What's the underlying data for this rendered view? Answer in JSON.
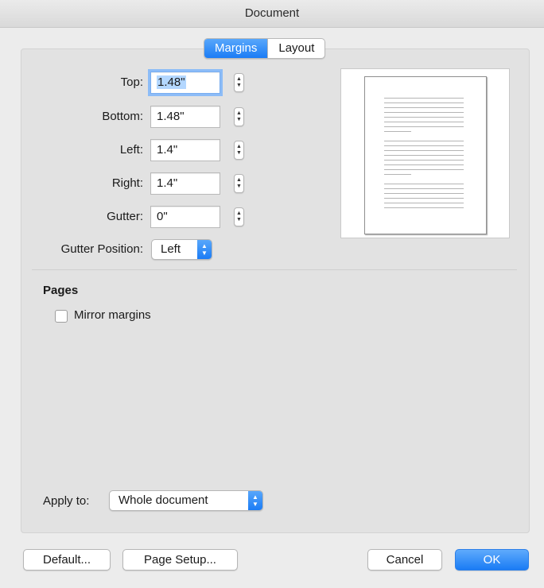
{
  "window": {
    "title": "Document"
  },
  "tabs": [
    {
      "label": "Margins",
      "active": true
    },
    {
      "label": "Layout",
      "active": false
    }
  ],
  "margins": {
    "top": {
      "label": "Top:",
      "value": "1.48\""
    },
    "bottom": {
      "label": "Bottom:",
      "value": "1.48\""
    },
    "left": {
      "label": "Left:",
      "value": "1.4\""
    },
    "right": {
      "label": "Right:",
      "value": "1.4\""
    },
    "gutter": {
      "label": "Gutter:",
      "value": "0\""
    },
    "gutter_position": {
      "label": "Gutter Position:",
      "value": "Left"
    }
  },
  "pages": {
    "heading": "Pages",
    "mirror_margins": {
      "label": "Mirror margins",
      "checked": false
    }
  },
  "apply_to": {
    "label": "Apply to:",
    "value": "Whole document"
  },
  "buttons": {
    "default": "Default...",
    "page_setup": "Page Setup...",
    "cancel": "Cancel",
    "ok": "OK"
  },
  "colors": {
    "accent": "#1b7cf5",
    "selection": "#b3d7ff"
  },
  "icons": {
    "stepper": "stepper-icon",
    "popup": "popup-arrows-icon"
  }
}
